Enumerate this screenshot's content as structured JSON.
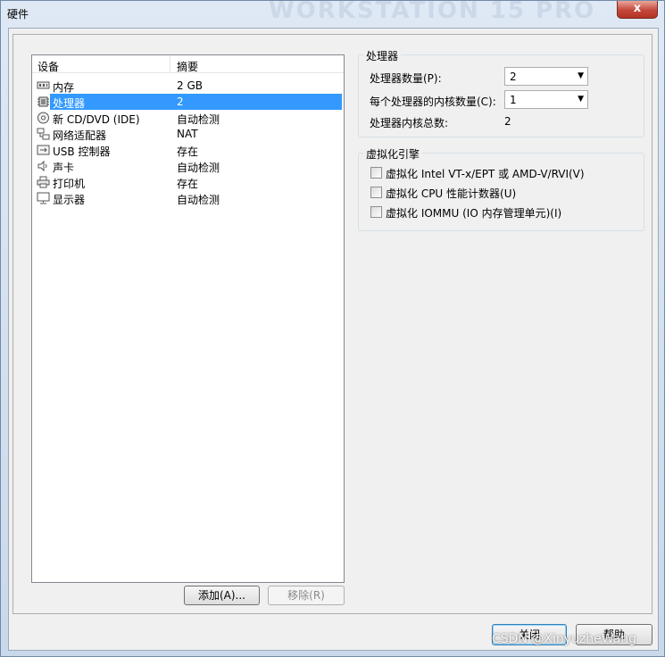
{
  "window": {
    "title": "硬件",
    "title_watermark": "WORKSTATION 15 PRO",
    "close_glyph": "x"
  },
  "device_list": {
    "columns": [
      "设备",
      "摘要"
    ],
    "rows": [
      {
        "icon": "memory-icon",
        "name": "内存",
        "summary": "2 GB",
        "selected": false
      },
      {
        "icon": "processor-icon",
        "name": "处理器",
        "summary": "2",
        "selected": true
      },
      {
        "icon": "cd-dvd-icon",
        "name": "新 CD/DVD (IDE)",
        "summary": "自动检测",
        "selected": false
      },
      {
        "icon": "network-adapter-icon",
        "name": "网络适配器",
        "summary": "NAT",
        "selected": false
      },
      {
        "icon": "usb-controller-icon",
        "name": "USB 控制器",
        "summary": "存在",
        "selected": false
      },
      {
        "icon": "sound-card-icon",
        "name": "声卡",
        "summary": "自动检测",
        "selected": false
      },
      {
        "icon": "printer-icon",
        "name": "打印机",
        "summary": "存在",
        "selected": false
      },
      {
        "icon": "display-icon",
        "name": "显示器",
        "summary": "自动检测",
        "selected": false
      }
    ]
  },
  "list_buttons": {
    "add": "添加(A)...",
    "remove": "移除(R)"
  },
  "processor_group": {
    "title": "处理器",
    "count_label": "处理器数量(P):",
    "count_value": "2",
    "cores_label": "每个处理器的内核数量(C):",
    "cores_value": "1",
    "total_label": "处理器内核总数:",
    "total_value": "2"
  },
  "virtualization_group": {
    "title": "虚拟化引擎",
    "options": [
      {
        "label": "虚拟化 Intel VT-x/EPT 或 AMD-V/RVI(V)",
        "checked": false
      },
      {
        "label": "虚拟化 CPU 性能计数器(U)",
        "checked": false
      },
      {
        "label": "虚拟化 IOMMU (IO 内存管理单元)(I)",
        "checked": false
      }
    ]
  },
  "footer_buttons": {
    "close": "关闭",
    "help": "帮助"
  },
  "watermark": "CSDN @XinyuzheWang",
  "colors": {
    "selection": "#3399ff",
    "close_button": "#c4483a"
  }
}
